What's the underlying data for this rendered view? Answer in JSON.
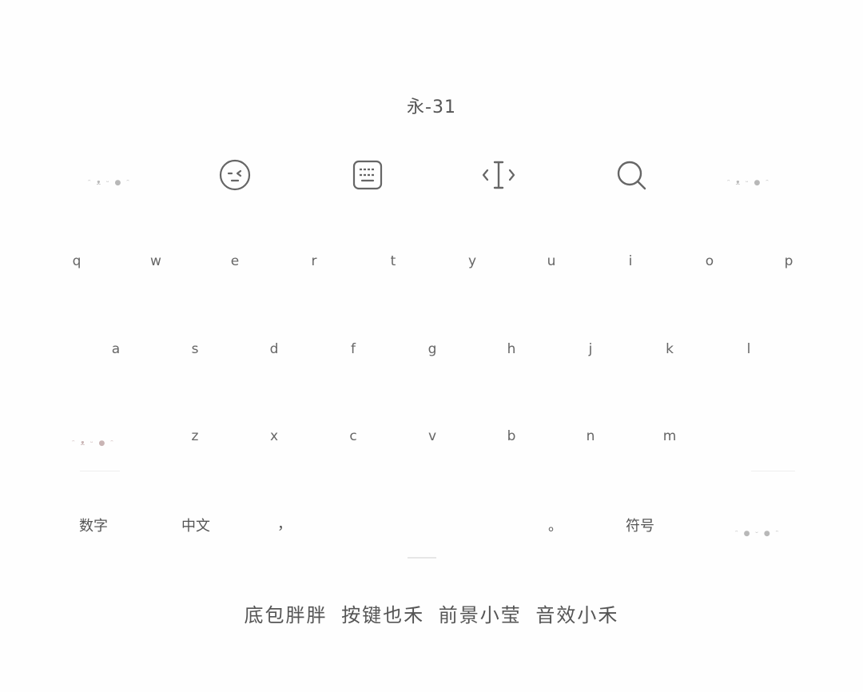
{
  "title": "永-31",
  "toolbar": {
    "icons": [
      "emoji-face-icon",
      "keyboard-icon",
      "cursor-move-icon",
      "search-icon"
    ]
  },
  "decorations": {
    "kaomoji_1": "ᵔ ᴥ ᵕ ● ᵔ",
    "kaomoji_2": "ᵔ ᴥ ᵕ ● ᵔ",
    "kaomoji_3": "ᵔ ᴥ ᵕ ● ᵔ",
    "kaomoji_4": "ᵔ ● ᵕ ● ᵔ"
  },
  "keyboard": {
    "row1": [
      "q",
      "w",
      "e",
      "r",
      "t",
      "y",
      "u",
      "i",
      "o",
      "p"
    ],
    "row2": [
      "a",
      "s",
      "d",
      "f",
      "g",
      "h",
      "j",
      "k",
      "l"
    ],
    "row3": [
      "z",
      "x",
      "c",
      "v",
      "b",
      "n",
      "m"
    ],
    "bottom": {
      "numbers": "数字",
      "chinese": "中文",
      "comma": "，",
      "period": "。",
      "symbols": "符号"
    }
  },
  "credits": "底包胖胖 按键也禾 前景小莹 音效小禾"
}
